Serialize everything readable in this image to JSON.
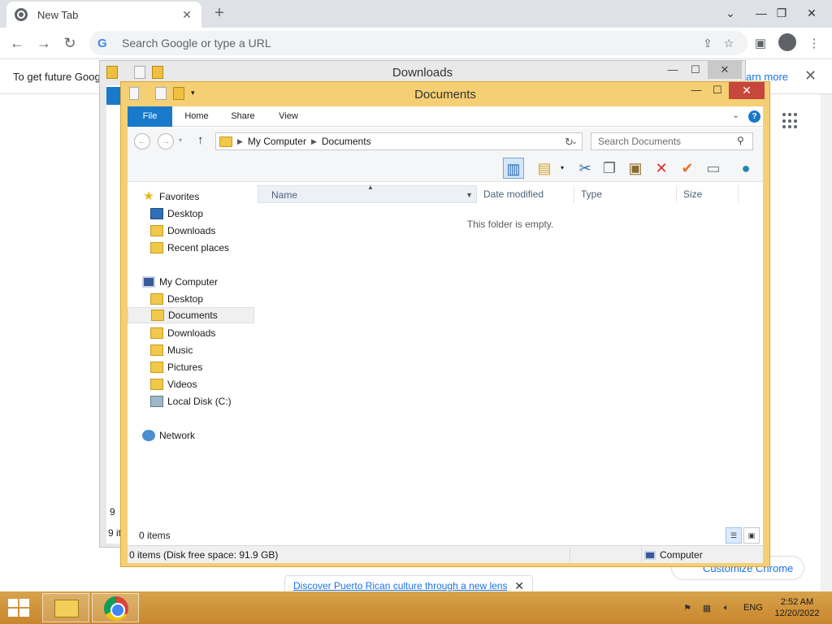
{
  "chrome": {
    "tab_title": "New Tab",
    "tab_close": "✕",
    "new_tab": "+",
    "omnibox_placeholder": "Search Google or type a URL",
    "infobar_text": "To get future Goog",
    "infobar_link": "arn more",
    "infobar_close": "✕",
    "discover_text": "Discover Puerto Rican culture through a new lens",
    "discover_close": "✕",
    "customize_label": "Customize Chrome",
    "icons": [
      "back-icon",
      "forward-icon",
      "reload-icon",
      "share-icon",
      "star-icon",
      "side-panel-icon",
      "profile-icon",
      "menu-icon",
      "apps-icon"
    ]
  },
  "downloads_window": {
    "title": "Downloads",
    "status_partial": "9 it",
    "side_partial": "9"
  },
  "explorer": {
    "title": "Documents",
    "ribbon_tabs": [
      "File",
      "Home",
      "Share",
      "View"
    ],
    "help": "?",
    "breadcrumb": [
      "My Computer",
      "Documents"
    ],
    "search_placeholder": "Search Documents",
    "nav_groups": {
      "favorites_label": "Favorites",
      "favorites": [
        "Desktop",
        "Downloads",
        "Recent places"
      ],
      "computer_label": "My Computer",
      "computer": [
        "Desktop",
        "Documents",
        "Downloads",
        "Music",
        "Pictures",
        "Videos",
        "Local Disk (C:)"
      ],
      "network_label": "Network",
      "selected": "Documents"
    },
    "columns": [
      "Name",
      "Date modified",
      "Type",
      "Size"
    ],
    "empty_message": "This folder is empty.",
    "items_count": "0 items",
    "status_left": "0 items (Disk free space: 91.9 GB)",
    "status_right": "Computer"
  },
  "taskbar": {
    "language": "ENG",
    "time": "2:52 AM",
    "date": "12/20/2022"
  }
}
